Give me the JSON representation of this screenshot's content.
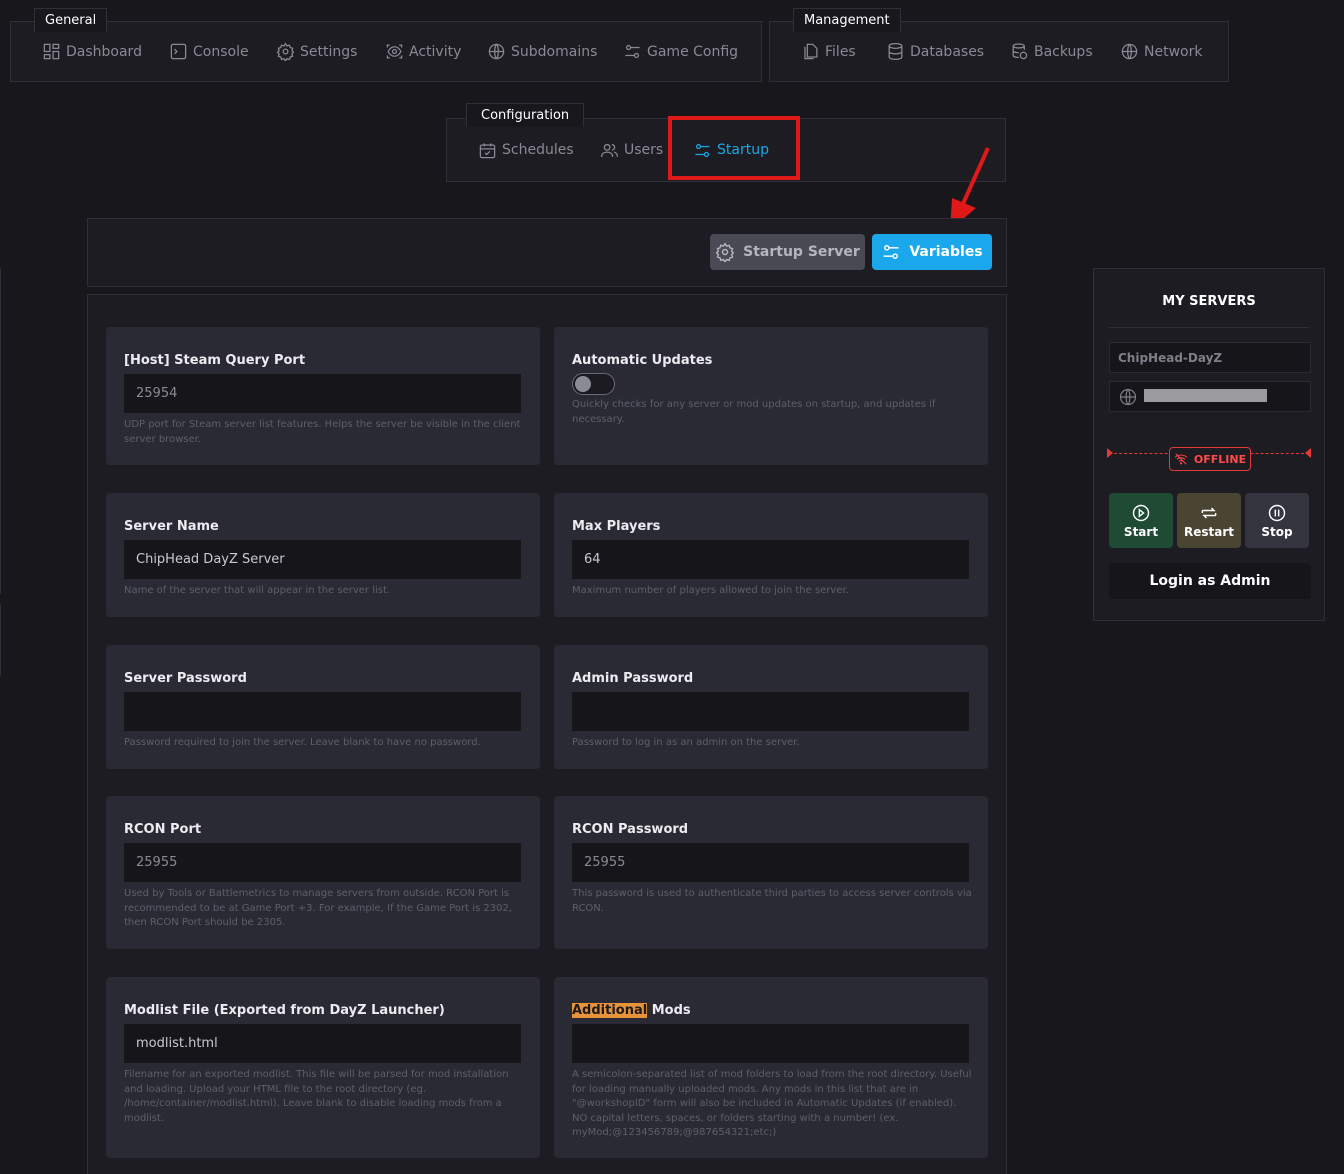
{
  "nav": {
    "general": {
      "legend": "General",
      "items": [
        {
          "label": "Dashboard",
          "icon": "dashboard-icon"
        },
        {
          "label": "Console",
          "icon": "terminal-icon"
        },
        {
          "label": "Settings",
          "icon": "gear-icon"
        },
        {
          "label": "Activity",
          "icon": "eye-icon"
        },
        {
          "label": "Subdomains",
          "icon": "globe-icon"
        },
        {
          "label": "Game Config",
          "icon": "sliders-icon"
        }
      ]
    },
    "management": {
      "legend": "Management",
      "items": [
        {
          "label": "Files",
          "icon": "files-icon"
        },
        {
          "label": "Databases",
          "icon": "database-icon"
        },
        {
          "label": "Backups",
          "icon": "backup-icon"
        },
        {
          "label": "Network",
          "icon": "globe-icon"
        }
      ]
    },
    "configuration": {
      "legend": "Configuration",
      "items": [
        {
          "label": "Schedules",
          "icon": "calendar-icon"
        },
        {
          "label": "Users",
          "icon": "users-icon"
        },
        {
          "label": "Startup",
          "icon": "sliders-icon",
          "active": true
        }
      ]
    }
  },
  "toolbar": {
    "startup_server_label": "Startup Server",
    "variables_label": "Variables"
  },
  "form": {
    "steam_query_port": {
      "label": "[Host] Steam Query Port",
      "value": "25954",
      "help": "UDP port for Steam server list features. Helps the server be visible in the client server browser."
    },
    "automatic_updates": {
      "label": "Automatic Updates",
      "enabled": false,
      "help": "Quickly checks for any server or mod updates on startup, and updates if necessary."
    },
    "server_name": {
      "label": "Server Name",
      "value": "ChipHead DayZ Server",
      "help": "Name of the server that will appear in the server list."
    },
    "max_players": {
      "label": "Max Players",
      "value": "64",
      "help": "Maximum number of players allowed to join the server."
    },
    "server_password": {
      "label": "Server Password",
      "value": "",
      "help": "Password required to join the server. Leave blank to have no password."
    },
    "admin_password": {
      "label": "Admin Password",
      "value": "",
      "help": "Password to log in as an admin on the server."
    },
    "rcon_port": {
      "label": "RCON Port",
      "value": "25955",
      "help": "Used by Tools or Battlemetrics to manage servers from outside. RCON Port is recommended to be at Game Port +3. For example, If the Game Port is 2302, then RCON Port should be 2305."
    },
    "rcon_password": {
      "label": "RCON Password",
      "value": "25955",
      "help": "This password is used to authenticate third parties to access server controls via RCON."
    },
    "modlist_file": {
      "label": "Modlist File (Exported from DayZ Launcher)",
      "value": "modlist.html",
      "help": "Filename for an exported modlist. This file will be parsed for mod installation and loading. Upload your HTML file to the root directory (eg. /home/container/modlist.html). Leave blank to disable loading mods from a modlist."
    },
    "additional_mods": {
      "label_highlight": "Additional",
      "label_rest": " Mods",
      "value": "",
      "help": "A semicolon-separated list of mod folders to load from the root directory. Useful for loading manually uploaded mods. Any mods in this list that are in \"@workshopID\" form will also be included in Automatic Updates (if enabled). NO capital letters, spaces, or folders starting with a number! (ex. myMod;@123456789;@987654321;etc;)"
    }
  },
  "servers": {
    "title": "MY SERVERS",
    "server_name": "ChipHead-DayZ",
    "status": "OFFLINE",
    "start_label": "Start",
    "restart_label": "Restart",
    "stop_label": "Stop",
    "login_label": "Login as Admin"
  },
  "colors": {
    "accent": "#1aa7ec",
    "offline": "#e43a3a",
    "start": "#1f4a34",
    "restart": "#4a4433",
    "stop": "#353540",
    "annotation": "#e01818"
  }
}
